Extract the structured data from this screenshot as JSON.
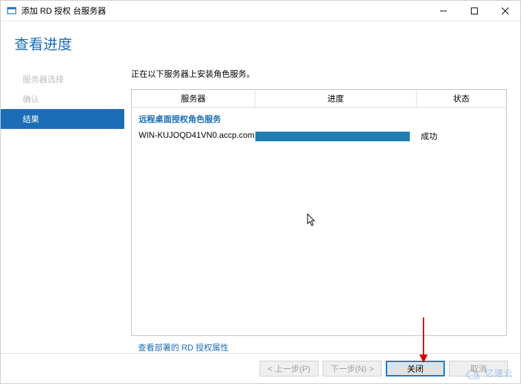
{
  "window": {
    "title": "添加 RD 授权 台服务器"
  },
  "header": {
    "title": "查看进度"
  },
  "sidebar": {
    "items": [
      {
        "label": "服务器选择",
        "active": false
      },
      {
        "label": "确认",
        "active": false
      },
      {
        "label": "结果",
        "active": true
      }
    ]
  },
  "content": {
    "intro": "正在以下服务器上安装角色服务。",
    "columns": {
      "server": "服务器",
      "progress": "进度",
      "status": "状态"
    },
    "section_title": "远程桌面授权角色服务",
    "rows": [
      {
        "server": "WIN-KUJOQD41VN0.accp.com",
        "status": "成功"
      }
    ],
    "link": "查看部署的 RD 授权属性"
  },
  "footer": {
    "prev": "< 上一步(P)",
    "next": "下一步(N) >",
    "close": "关闭",
    "cancel": "取消"
  },
  "watermark": {
    "text": "亿速云"
  }
}
